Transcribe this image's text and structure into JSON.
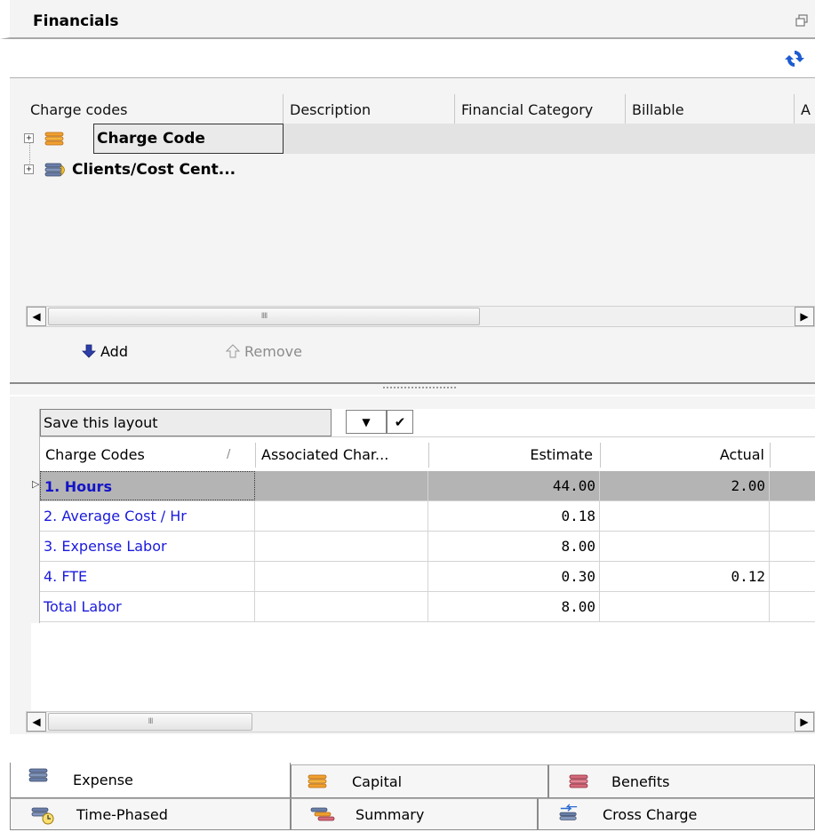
{
  "window": {
    "title": "Financials"
  },
  "upper": {
    "columns": [
      "Charge codes",
      "Description",
      "Financial Category",
      "Billable",
      "A"
    ],
    "tree": [
      {
        "label": "Charge Code",
        "expander": "+"
      },
      {
        "label": "Clients/Cost Cent...",
        "expander": "+"
      }
    ],
    "scrollbar": {
      "grip": "IIII"
    },
    "add_label": "Add",
    "remove_label": "Remove"
  },
  "lower": {
    "layout_name": "Save this layout",
    "dropdown_glyph": "▼",
    "confirm_glyph": "✔",
    "columns": {
      "charge_codes": "Charge Codes",
      "sort_glyph": "/",
      "associated": "Associated Char...",
      "estimate": "Estimate",
      "actual": "Actual"
    },
    "rows": [
      {
        "name": "1. Hours",
        "estimate": "44.00",
        "actual": "2.00",
        "selected": true
      },
      {
        "name": "2. Average Cost / Hr",
        "estimate": "0.18",
        "actual": ""
      },
      {
        "name": "3. Expense Labor",
        "estimate": "8.00",
        "actual": ""
      },
      {
        "name": "4. FTE",
        "estimate": "0.30",
        "actual": "0.12"
      },
      {
        "name": "Total Labor",
        "estimate": "8.00",
        "actual": ""
      }
    ],
    "row_indicator": "▷",
    "scrollbar": {
      "grip": "III"
    }
  },
  "tabs": [
    {
      "label": "Expense",
      "icon": "expense-stack-icon",
      "active": true
    },
    {
      "label": "Capital",
      "icon": "capital-stack-icon"
    },
    {
      "label": "Benefits",
      "icon": "benefits-stack-icon"
    },
    {
      "label": "Time-Phased",
      "icon": "time-phased-icon"
    },
    {
      "label": "Summary",
      "icon": "summary-stack-icon"
    },
    {
      "label": "Cross Charge",
      "icon": "cross-charge-icon"
    }
  ],
  "colors": {
    "link_blue": "#1a1adc",
    "selected_row": "#b4b4b4",
    "panel_bg": "#f4f4f4",
    "refresh_blue": "#1c5cd0"
  }
}
